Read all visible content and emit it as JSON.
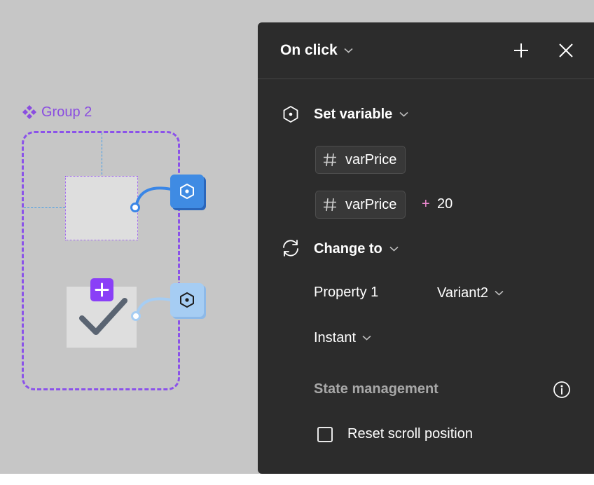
{
  "canvas": {
    "group_label": "Group 2",
    "accent_color": "#8b52ea",
    "icons": {
      "group": "component-diamond-icon",
      "add": "plus-icon",
      "check": "checkmark-icon",
      "trigger": "interaction-hexagon-icon"
    }
  },
  "panel": {
    "trigger_label": "On click",
    "icons": {
      "add": "plus-icon",
      "close": "close-icon"
    },
    "actions": [
      {
        "title": "Set variable",
        "icon": "hexagon-variable-icon",
        "target_variable": "varPrice",
        "value_expression": {
          "variable": "varPrice",
          "operator": "+",
          "operand": "20"
        }
      },
      {
        "title": "Change to",
        "icon": "cycle-arrows-icon",
        "property_label": "Property 1",
        "property_value": "Variant2",
        "animation": "Instant"
      }
    ],
    "state_management": {
      "title": "State management",
      "info_icon": "info-icon",
      "reset_scroll_label": "Reset scroll position",
      "reset_scroll_checked": false
    }
  }
}
